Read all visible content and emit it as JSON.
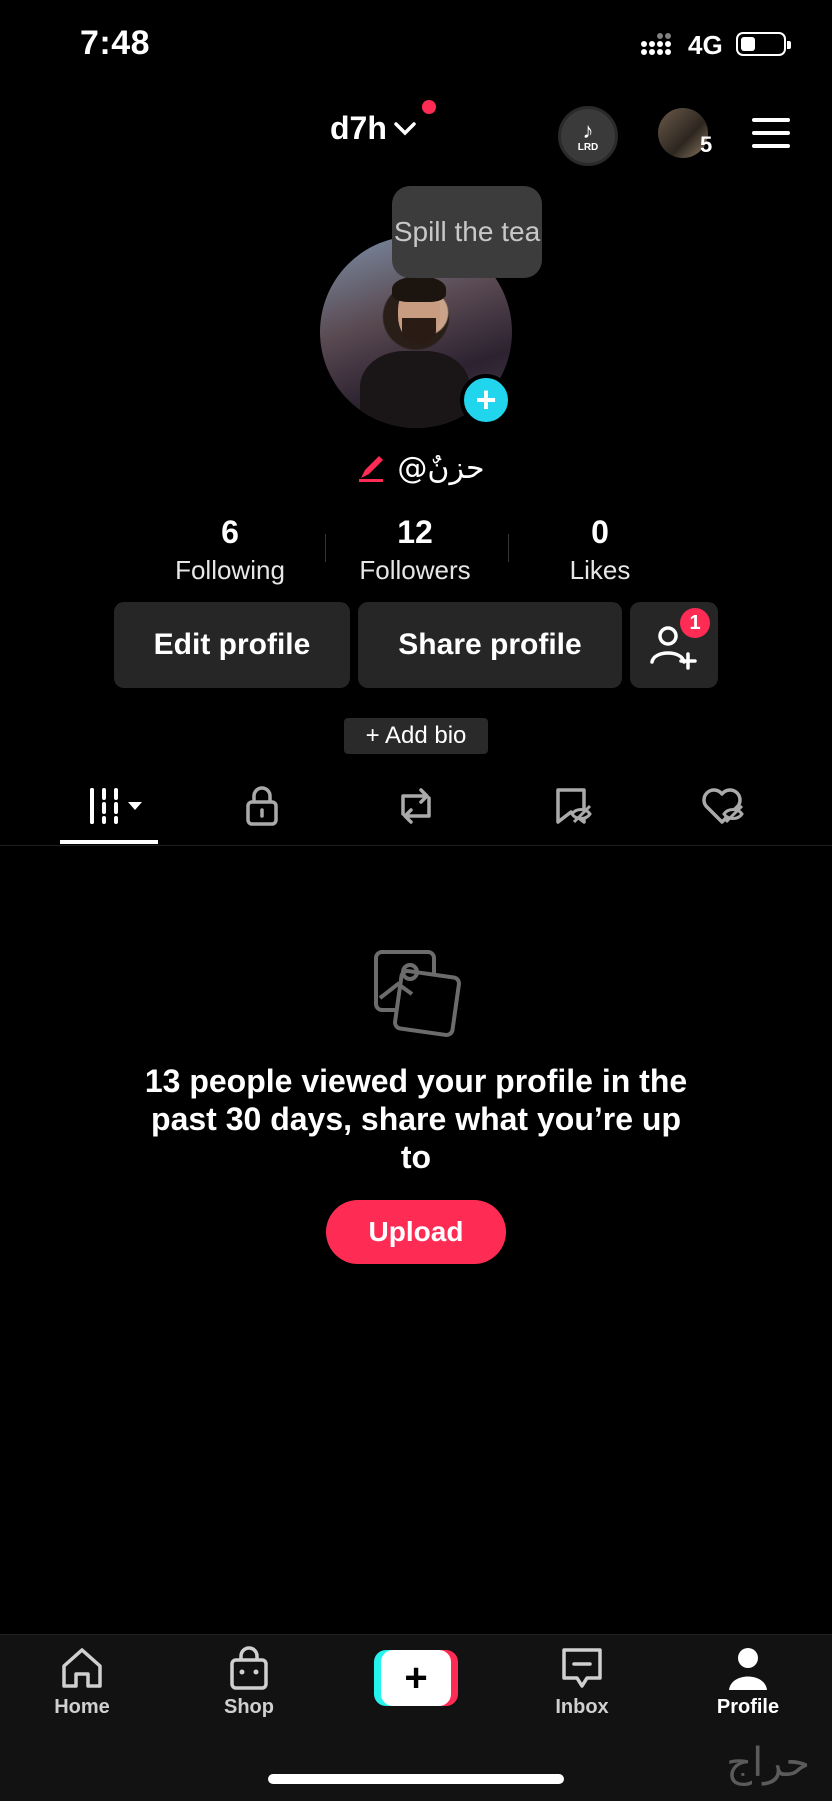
{
  "status_bar": {
    "time": "7:48",
    "network": "4G"
  },
  "header": {
    "username": "d7h",
    "lrd_label": "LRD",
    "accounts_count": "5"
  },
  "profile": {
    "tooltip": "Spill the tea",
    "handle": "@حزنٌ",
    "stats": [
      {
        "value": "6",
        "label": "Following"
      },
      {
        "value": "12",
        "label": "Followers"
      },
      {
        "value": "0",
        "label": "Likes"
      }
    ],
    "edit_label": "Edit profile",
    "share_label": "Share profile",
    "friend_badge": "1",
    "bio_label": "+ Add bio"
  },
  "tabs": [
    "videos-icon",
    "lock-icon",
    "repost-icon",
    "favorites-icon",
    "liked-icon"
  ],
  "empty_state": {
    "message": "13 people viewed your profile in the past 30 days, share what you’re up to",
    "upload_label": "Upload"
  },
  "bottom_nav": {
    "home": "Home",
    "shop": "Shop",
    "inbox": "Inbox",
    "profile": "Profile"
  },
  "watermark": "حراج",
  "colors": {
    "accent": "#fe2c55",
    "cyan": "#20d5ec",
    "background": "#000000",
    "button": "#262626"
  }
}
